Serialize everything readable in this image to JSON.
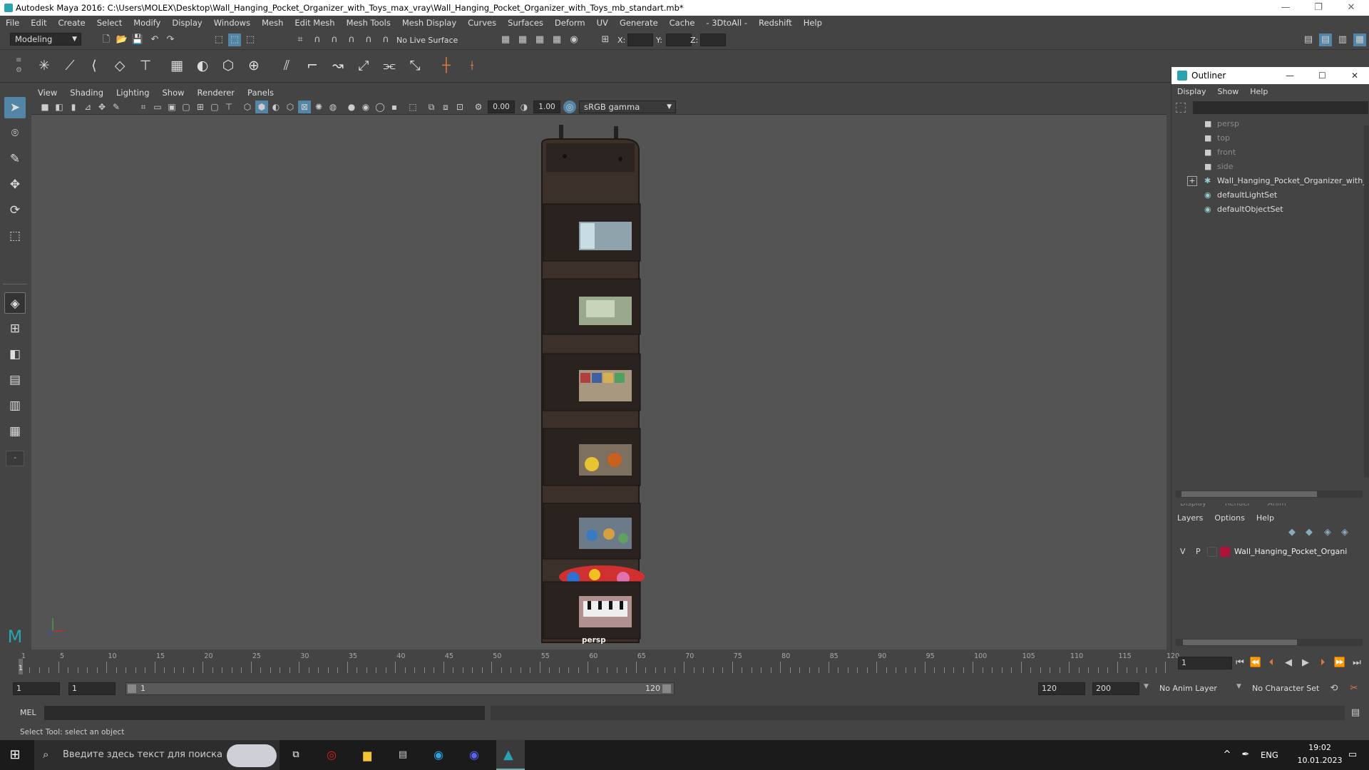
{
  "title": "Autodesk Maya 2016: C:\\Users\\MOLEX\\Desktop\\Wall_Hanging_Pocket_Organizer_with_Toys_max_vray\\Wall_Hanging_Pocket_Organizer_with_Toys_mb_standart.mb*",
  "window_controls": {
    "minimize": "—",
    "restore": "❐",
    "close": "✕"
  },
  "menu": [
    "File",
    "Edit",
    "Create",
    "Select",
    "Modify",
    "Display",
    "Windows",
    "Mesh",
    "Edit Mesh",
    "Mesh Tools",
    "Mesh Display",
    "Curves",
    "Surfaces",
    "Deform",
    "UV",
    "Generate",
    "Cache",
    "- 3DtoAll -",
    "Redshift",
    "Help"
  ],
  "status": {
    "mode": "Modeling",
    "live_surface": "No Live Surface",
    "x_label": "X:",
    "y_label": "Y:",
    "z_label": "Z:"
  },
  "viewport": {
    "menu": [
      "View",
      "Shading",
      "Lighting",
      "Show",
      "Renderer",
      "Panels"
    ],
    "exposure": "0.00",
    "gamma": "1.00",
    "color_space": "sRGB gamma",
    "camera_label": "persp"
  },
  "outliner": {
    "title": "Outliner",
    "menu": [
      "Display",
      "Show",
      "Help"
    ],
    "items": [
      {
        "label": "persp"
      },
      {
        "label": "top"
      },
      {
        "label": "front"
      },
      {
        "label": "side"
      },
      {
        "label": "Wall_Hanging_Pocket_Organizer_with_"
      },
      {
        "label": "defaultLightSet"
      },
      {
        "label": "defaultObjectSet"
      }
    ],
    "expand": "+"
  },
  "layers": {
    "tabs": [
      "Display",
      "Render",
      "Anim"
    ],
    "menu": [
      "Layers",
      "Options",
      "Help"
    ],
    "row": {
      "v": "V",
      "p": "P",
      "name": "Wall_Hanging_Pocket_Organi",
      "color": "#b0123a"
    }
  },
  "timeline": {
    "ticks": [
      "1",
      "5",
      "10",
      "15",
      "20",
      "25",
      "30",
      "35",
      "40",
      "45",
      "50",
      "55",
      "60",
      "65",
      "70",
      "75",
      "80",
      "85",
      "90",
      "95",
      "100",
      "105",
      "110",
      "115",
      "120"
    ],
    "current_frame": "1"
  },
  "range": {
    "start": "1",
    "playback_start": "1",
    "slider_start": "1",
    "slider_end": "120",
    "playback_end": "120",
    "end": "200",
    "anim_layer": "No Anim Layer",
    "character_set": "No Character Set"
  },
  "cmd": {
    "label": "MEL"
  },
  "helpline": "Select Tool: select an object",
  "taskbar": {
    "search_placeholder": "Введите здесь текст для поиска",
    "lang": "ENG",
    "time": "19:02",
    "date": "10.01.2023"
  },
  "colors": {
    "accent": "#5285a6",
    "bg": "#444444",
    "viewport": "#545454"
  }
}
